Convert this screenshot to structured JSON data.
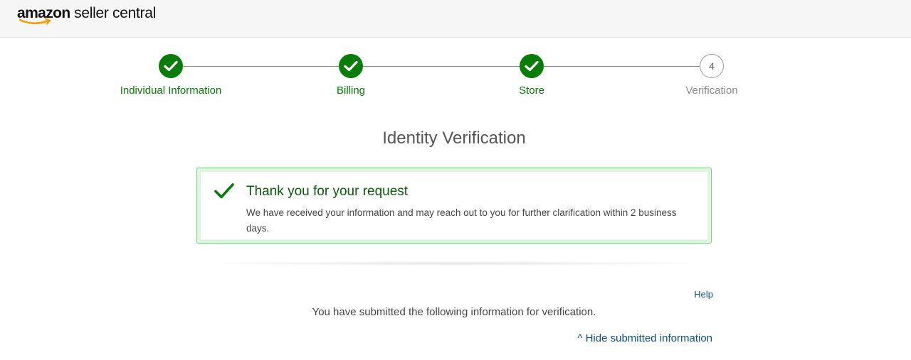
{
  "header": {
    "logo_brand": "amazon",
    "logo_product": " seller central"
  },
  "stepper": {
    "steps": [
      {
        "label": "Individual Information",
        "status": "complete"
      },
      {
        "label": "Billing",
        "status": "complete"
      },
      {
        "label": "Store",
        "status": "complete"
      },
      {
        "label": "Verification",
        "status": "pending",
        "number": "4"
      }
    ]
  },
  "main": {
    "title": "Identity Verification",
    "alert": {
      "heading": "Thank you for your request",
      "body": "We have received your information and may reach out to you for further clarification within 2 business days."
    },
    "help_label": "Help",
    "submitted_text": "You have submitted the following information for verification.",
    "toggle_label": "^ Hide submitted information"
  },
  "colors": {
    "success": "#067d06",
    "link": "#0d4f78",
    "alert_border": "#7fcf83"
  }
}
